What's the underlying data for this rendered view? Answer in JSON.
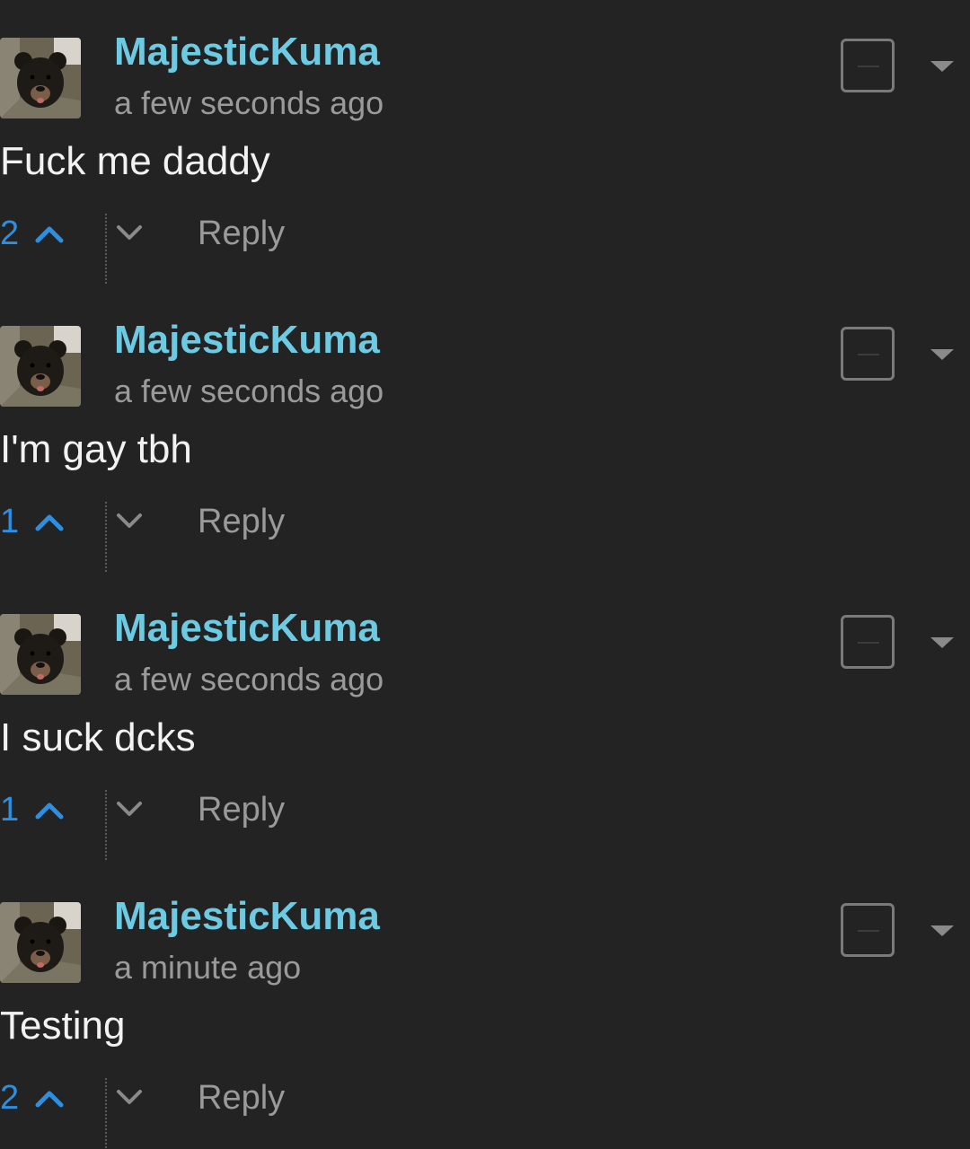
{
  "comments": [
    {
      "username": "MajesticKuma",
      "time": "a few seconds ago",
      "body": "Fuck me daddy",
      "votes": "2",
      "reply_label": "Reply"
    },
    {
      "username": "MajesticKuma",
      "time": "a few seconds ago",
      "body": "I'm gay tbh",
      "votes": "1",
      "reply_label": "Reply"
    },
    {
      "username": "MajesticKuma",
      "time": "a few seconds ago",
      "body": "I suck dcks",
      "votes": "1",
      "reply_label": "Reply"
    },
    {
      "username": "MajesticKuma",
      "time": "a minute ago",
      "body": "Testing",
      "votes": "2",
      "reply_label": "Reply"
    }
  ],
  "colors": {
    "background": "#232323",
    "username": "#6ccbe2",
    "vote_count": "#2e8fe0",
    "muted_text": "#9a9a9a",
    "body_text": "#f2f2f2"
  },
  "icons": {
    "avatar": "bear-cub-avatar",
    "upvote": "chevron-up-icon",
    "downvote": "chevron-down-icon",
    "collapse": "collapse-box-icon",
    "menu": "dropdown-arrow-icon"
  }
}
